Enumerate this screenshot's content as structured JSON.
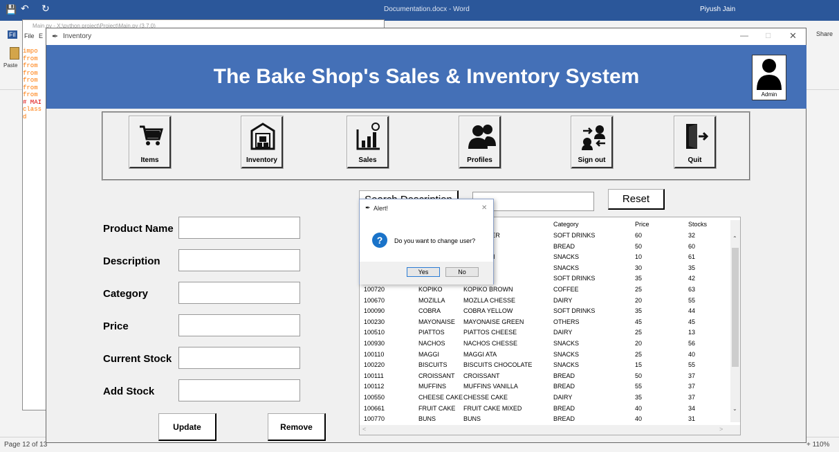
{
  "word": {
    "title": "Documentation.docx - Word",
    "user": "Piyush Jain",
    "share": "Share",
    "paste": "Paste",
    "file_tab": "Fil",
    "status_page": "Page 12 of 13",
    "zoom": "+ 110%"
  },
  "idle": {
    "title": "Main.py - X:\\python project\\Project\\Main.py (3.7.0)",
    "menu": [
      "File",
      "E"
    ],
    "code_lines": [
      "impo",
      "from",
      "from",
      "from",
      "from",
      "from",
      "from",
      "",
      "# MAI",
      "class",
      "",
      "    d"
    ]
  },
  "inventory": {
    "window_title": "Inventory",
    "banner_title": "The Bake Shop's Sales & Inventory System",
    "admin_label": "Admin",
    "nav": [
      {
        "label": "Items",
        "icon": "cart-icon"
      },
      {
        "label": "Inventory",
        "icon": "warehouse-icon"
      },
      {
        "label": "Sales",
        "icon": "sales-chart-icon"
      },
      {
        "label": "Profiles",
        "icon": "users-icon"
      },
      {
        "label": "Sign out",
        "icon": "switch-user-icon"
      },
      {
        "label": "Quit",
        "icon": "exit-door-icon"
      }
    ],
    "form": {
      "product_name": "Product Name",
      "description": "Description",
      "category": "Category",
      "price": "Price",
      "current_stock": "Current Stock",
      "add_stock": "Add Stock"
    },
    "buttons": {
      "update": "Update",
      "remove": "Remove",
      "search": "Search Description",
      "reset": "Reset"
    },
    "table": {
      "headers": [
        "",
        "",
        "ion",
        "Category",
        "Price",
        "Stocks"
      ],
      "rows": [
        [
          "",
          "",
          "ROOT BEER",
          "SOFT DRINKS",
          "60",
          "32"
        ],
        [
          "",
          "",
          "IES",
          "BREAD",
          "50",
          "60"
        ],
        [
          "",
          "",
          "LAS PLAIN",
          "SNACKS",
          "10",
          "61"
        ],
        [
          "",
          "",
          "S",
          "SNACKS",
          "30",
          "35"
        ],
        [
          "",
          "",
          "ERO",
          "SOFT DRINKS",
          "35",
          "42"
        ],
        [
          "100720",
          "KOPIKO",
          "KOPIKO BROWN",
          "COFFEE",
          "25",
          "63"
        ],
        [
          "100670",
          "MOZILLA",
          "MOZLLA CHESSE",
          "DAIRY",
          "20",
          "55"
        ],
        [
          "100090",
          "COBRA",
          "COBRA YELLOW",
          "SOFT DRINKS",
          "35",
          "44"
        ],
        [
          "100230",
          "MAYONAISE",
          "MAYONAISE GREEN",
          "OTHERS",
          "45",
          "45"
        ],
        [
          "100510",
          "PIATTOS",
          "PIATTOS CHEESE",
          "DAIRY",
          "25",
          "13"
        ],
        [
          "100930",
          "NACHOS",
          "NACHOS CHESSE",
          "SNACKS",
          "20",
          "56"
        ],
        [
          "100110",
          "MAGGI",
          "MAGGI ATA",
          "SNACKS",
          "25",
          "40"
        ],
        [
          "100220",
          "BISCUITS",
          "BISCUITS CHOCOLATE",
          "SNACKS",
          "15",
          "55"
        ],
        [
          "100111",
          "CROISSANT",
          "CROISSANT",
          "BREAD",
          "50",
          "37"
        ],
        [
          "100112",
          "MUFFINS",
          "MUFFINS VANILLA",
          "BREAD",
          "55",
          "37"
        ],
        [
          "100550",
          "CHEESE CAKE",
          "CHESSE CAKE",
          "DAIRY",
          "35",
          "37"
        ],
        [
          "100661",
          "FRUIT CAKE",
          "FRUIT CAKE MIXED",
          "BREAD",
          "40",
          "34"
        ],
        [
          "100770",
          "BUNS",
          "BUNS",
          "BREAD",
          "40",
          "31"
        ]
      ]
    }
  },
  "dialog": {
    "title": "Alert!",
    "message": "Do you want to change user?",
    "yes": "Yes",
    "no": "No"
  },
  "colors": {
    "banner": "#4470b7",
    "word": "#2b579a"
  }
}
